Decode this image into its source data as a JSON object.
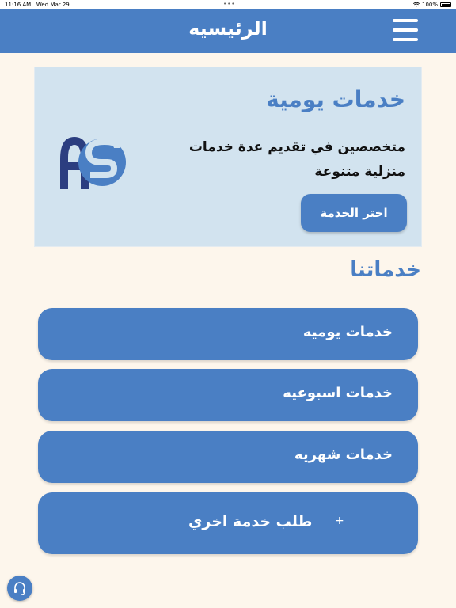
{
  "status_bar": {
    "time": "11:16 AM",
    "date": "Wed Mar 29",
    "battery": "100%"
  },
  "navbar": {
    "title": "الرئيسيه",
    "menu_icon": "hamburger-menu-icon"
  },
  "hero": {
    "title": "خدمات يومية",
    "description": "متخصصين في تقديم عدة خدمات منزلية متنوعة",
    "button_label": "اختر الخدمة",
    "logo_text": "AS"
  },
  "section": {
    "title": "خدماتنا"
  },
  "services": [
    {
      "label": "خدمات يوميه"
    },
    {
      "label": "خدمات اسبوعيه"
    },
    {
      "label": "خدمات شهريه"
    },
    {
      "label": "طلب خدمة اخري",
      "icon": "+"
    }
  ],
  "support_icon": "headset-icon",
  "colors": {
    "primary": "#4a7fc4",
    "background": "#fdf6ec",
    "hero_background": "#d2e3ef",
    "logo_dark": "#2c3e80"
  }
}
